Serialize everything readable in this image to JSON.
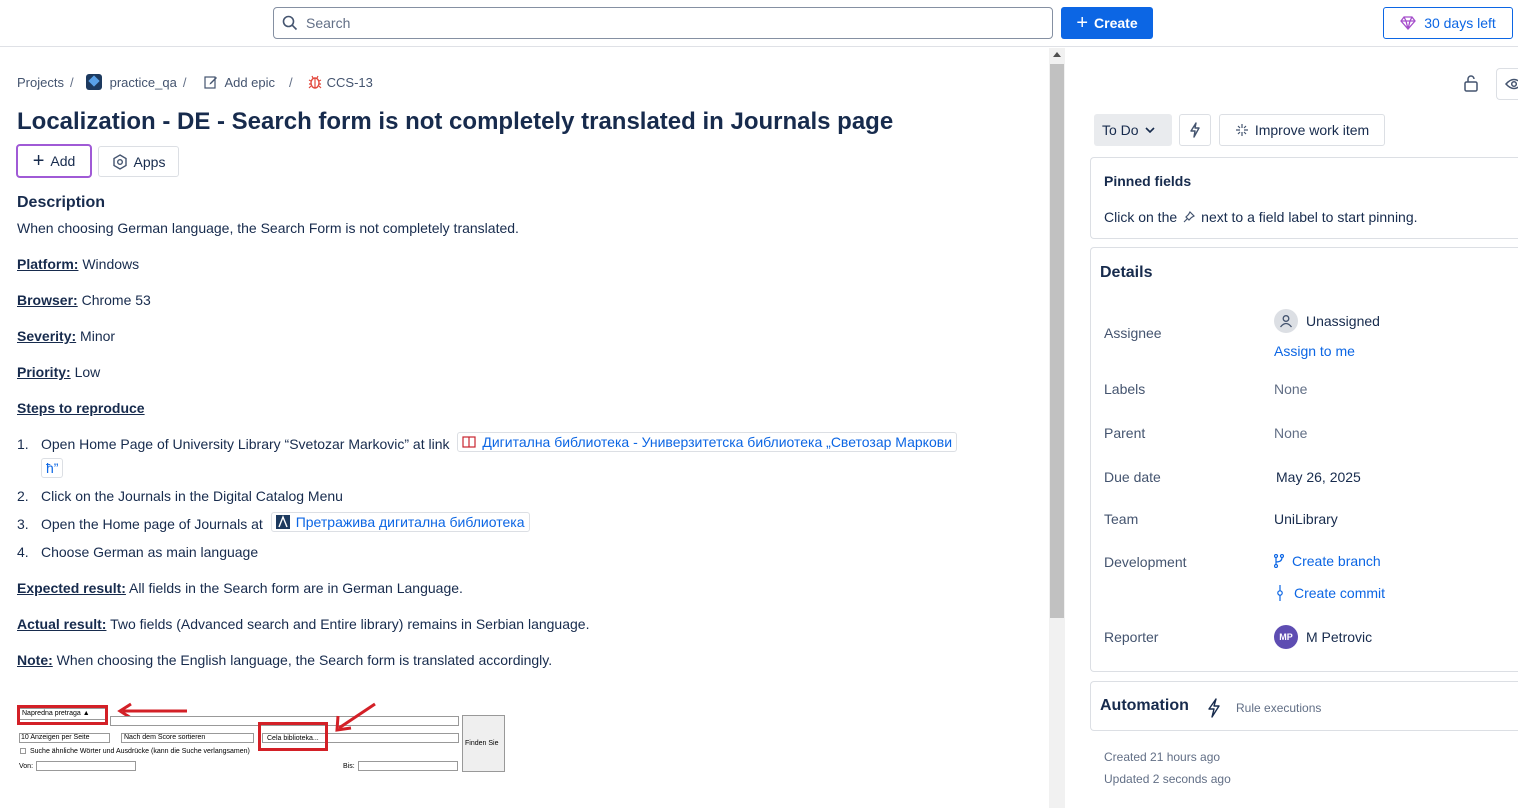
{
  "topbar": {
    "search_placeholder": "Search",
    "create_label": "Create",
    "trial_label": "30 days left"
  },
  "breadcrumb": {
    "projects": "Projects",
    "project": "practice_qa",
    "add_epic": "Add epic",
    "issue_key": "CCS-13"
  },
  "issue": {
    "title": "Localization - DE - Search form is not completely translated in Journals page",
    "add_label": "Add",
    "apps_label": "Apps",
    "description_heading": "Description",
    "description_intro": "When choosing German language, the Search Form is not completely translated.",
    "fields": [
      {
        "label": "Platform:",
        "value": " Windows"
      },
      {
        "label": "Browser:",
        "value": " Chrome 53"
      },
      {
        "label": "Severity:",
        "value": " Minor"
      },
      {
        "label": "Priority:",
        "value": " Low"
      }
    ],
    "steps_heading": "Steps to reproduce",
    "steps": {
      "s1_num": "1.",
      "s1_text": "Open Home Page of University Library “Svetozar Markovic” at link",
      "s1_link_a": "Дигитална библиотека - Универзитетска библиотека „Светозар Маркови",
      "s1_link_b": "ћ”",
      "s2_num": "2.",
      "s2_text": "Click on the Journals in the Digital Catalog Menu",
      "s3_num": "3.",
      "s3_text": "Open the Home page of Journals at",
      "s3_link": "Претражива дигитална библиотека",
      "s4_num": "4.",
      "s4_text": "Choose German as main language"
    },
    "expected_label": "Expected result:",
    "expected_value": " All fields in the Search form are in German Language.",
    "actual_label": "Actual result:",
    "actual_value": " Two fields (Advanced search and Entire library) remains in Serbian language.",
    "note_label": "Note:",
    "note_value": " When choosing the English language, the Search form is translated accordingly."
  },
  "attachment": {
    "advanced": "Napredna pretraga ▲",
    "per_page": "10 Anzeigen per Seite",
    "sort": "Nach dem Score sortieren",
    "library": "Cela biblioteka...",
    "find": "Finden Sie",
    "similar": "Suche ähnliche Wörter und Ausdrücke (kann die Suche verlangsamen)",
    "from": "Von:",
    "to": "Bis:"
  },
  "sidebar": {
    "status": "To Do",
    "improve_label": "Improve work item",
    "pinned_heading": "Pinned fields",
    "pinned_text_a": "Click on the",
    "pinned_text_b": "next to a field label to start pinning.",
    "details_heading": "Details",
    "assignee_label": "Assignee",
    "assignee_value": "Unassigned",
    "assign_to_me": "Assign to me",
    "labels_label": "Labels",
    "labels_value": "None",
    "parent_label": "Parent",
    "parent_value": "None",
    "due_label": "Due date",
    "due_value": "May 26, 2025",
    "team_label": "Team",
    "team_value": "UniLibrary",
    "dev_label": "Development",
    "create_branch": "Create branch",
    "create_commit": "Create commit",
    "reporter_label": "Reporter",
    "reporter_initials": "MP",
    "reporter_name": "M Petrovic",
    "automation_heading": "Automation",
    "rule_executions": "Rule executions",
    "created": "Created 21 hours ago",
    "updated": "Updated 2 seconds ago"
  },
  "colors": {
    "primary": "#0c66e4",
    "add_outline": "#a05ad6",
    "annotation_red": "#d32027",
    "reporter_avatar": "#5e4db2"
  }
}
